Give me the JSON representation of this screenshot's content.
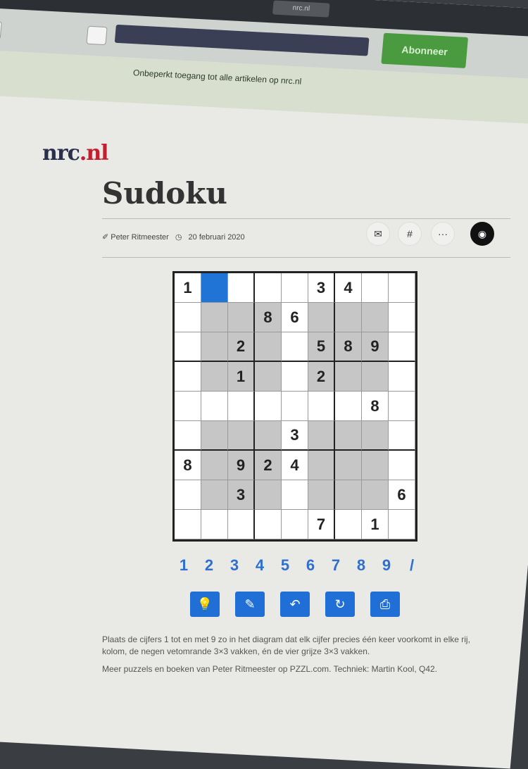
{
  "browser": {
    "tab_title": "nrc.nl",
    "subscribe_label": "Abonneer"
  },
  "banner": {
    "text": "Onbeperkt toegang tot alle artikelen op nrc.nl"
  },
  "site": {
    "logo_main": "nrc",
    "logo_suffix": ".nl"
  },
  "article": {
    "title": "Sudoku",
    "author": "Peter Ritmeester",
    "date": "20 februari 2020",
    "share_icons": [
      "mail-icon",
      "hash-icon",
      "more-icon",
      "whatsapp-icon"
    ],
    "share_glyphs": [
      "✉",
      "#",
      "···",
      "◉"
    ]
  },
  "puzzle": {
    "rows": [
      [
        "1",
        "",
        "",
        "",
        "",
        "3",
        "4",
        "",
        ""
      ],
      [
        "",
        "",
        "",
        "8",
        "6",
        "",
        "",
        "",
        ""
      ],
      [
        "",
        "",
        "2",
        "",
        "",
        "5",
        "8",
        "9",
        ""
      ],
      [
        "",
        "",
        "1",
        "",
        "",
        "2",
        "",
        "",
        ""
      ],
      [
        "",
        "",
        "",
        "",
        "",
        "",
        "",
        "8",
        ""
      ],
      [
        "",
        "",
        "",
        "",
        "3",
        "",
        "",
        "",
        ""
      ],
      [
        "8",
        "",
        "9",
        "2",
        "4",
        "",
        "",
        "",
        ""
      ],
      [
        "",
        "",
        "3",
        "",
        "",
        "",
        "",
        "",
        "6"
      ],
      [
        "",
        "",
        "",
        "",
        "",
        "7",
        "",
        "1",
        ""
      ]
    ],
    "selected_cell": "row1-col2",
    "number_buttons": [
      "1",
      "2",
      "3",
      "4",
      "5",
      "6",
      "7",
      "8",
      "9",
      "/"
    ],
    "tools": [
      {
        "icon": "lightbulb-icon",
        "glyph": "💡"
      },
      {
        "icon": "eraser-icon",
        "glyph": "✎"
      },
      {
        "icon": "undo-icon",
        "glyph": "↶"
      },
      {
        "icon": "redo-icon",
        "glyph": "↻"
      },
      {
        "icon": "print-icon",
        "glyph": "⎙"
      }
    ]
  },
  "instructions": {
    "p1": "Plaats de cijfers 1 tot en met 9 zo in het diagram dat elk cijfer precies één keer voorkomt in elke rij, kolom, de negen vetomrande 3×3 vakken, én de vier grijze 3×3 vakken.",
    "p2": "Meer puzzels en boeken van Peter Ritmeester op PZZL.com. Techniek: Martin Kool, Q42."
  },
  "colors": {
    "accent": "#1f6fd6",
    "subscribe": "#4a9a40"
  }
}
